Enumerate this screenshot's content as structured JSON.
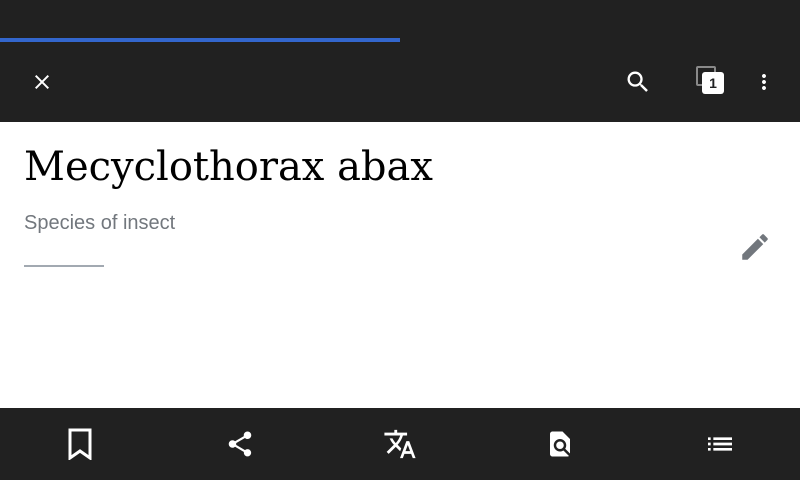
{
  "progress": {
    "fraction": 0.5,
    "color": "#3366cc"
  },
  "toolbar": {
    "close_icon": "close-icon",
    "search_icon": "search-icon",
    "tabs_count": "1",
    "overflow_icon": "more-vert-icon"
  },
  "article": {
    "title": "Mecyclothorax abax",
    "description": "Species of insect",
    "edit_icon": "pencil-icon"
  },
  "bottom_bar": {
    "items": [
      "bookmark-icon",
      "share-icon",
      "translate-icon",
      "find-in-page-icon",
      "contents-icon"
    ]
  },
  "colors": {
    "bar_background": "#212121",
    "icon": "#ffffff",
    "description_text": "#72777d",
    "edit_icon": "#72777d"
  }
}
